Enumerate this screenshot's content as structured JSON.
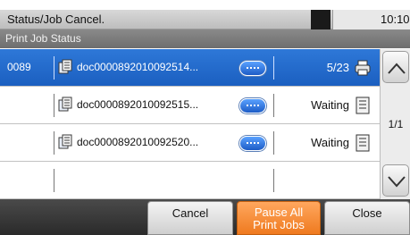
{
  "header": {
    "title": "Status/Job Cancel.",
    "time": "10:10"
  },
  "subheader": {
    "title": "Print Job Status"
  },
  "jobs": [
    {
      "id": "0089",
      "name": "doc0000892010092514...",
      "status": "5/23",
      "selected": true,
      "icon": "printer-icon"
    },
    {
      "id": "",
      "name": "doc0000892010092515...",
      "status": "Waiting",
      "selected": false,
      "icon": "waiting-doc-icon"
    },
    {
      "id": "",
      "name": "doc0000892010092520...",
      "status": "Waiting",
      "selected": false,
      "icon": "waiting-doc-icon"
    },
    {
      "id": "",
      "name": "",
      "status": "",
      "selected": false,
      "icon": ""
    }
  ],
  "scroll": {
    "page": "1/1"
  },
  "footer": {
    "cancel_label": "Cancel",
    "pause_label_line1": "Pause All",
    "pause_label_line2": "Print Jobs",
    "close_label": "Close"
  },
  "colors": {
    "selected_row": "#1b5fc0",
    "pause_button": "#ef7a1f"
  }
}
